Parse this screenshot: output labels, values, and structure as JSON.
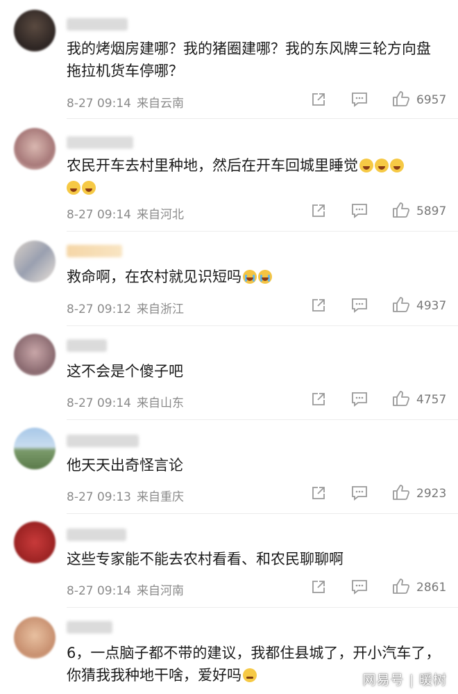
{
  "comments": [
    {
      "text": "我的烤烟房建哪？我的猪圈建哪？我的东风牌三轮方向盘拖拉机货车停哪？",
      "time": "8-27 09:14",
      "location": "来自云南",
      "likes": "6957",
      "emojis": []
    },
    {
      "text": "农民开车去村里种地，然后在开车回城里睡觉",
      "time": "8-27 09:14",
      "location": "来自河北",
      "likes": "5897",
      "emojis": [
        "laugh-cry-emoji",
        "laugh-cry-emoji",
        "laugh-cry-emoji",
        "laugh-cry-emoji",
        "laugh-cry-emoji"
      ]
    },
    {
      "text": "救命啊，在农村就见识短吗",
      "time": "8-27 09:12",
      "location": "来自浙江",
      "likes": "4937",
      "emojis": [
        "crying-emoji",
        "crying-emoji"
      ]
    },
    {
      "text": "这不会是个傻子吧",
      "time": "8-27 09:14",
      "location": "来自山东",
      "likes": "4757",
      "emojis": []
    },
    {
      "text": "他天天出奇怪言论",
      "time": "8-27 09:13",
      "location": "来自重庆",
      "likes": "2923",
      "emojis": []
    },
    {
      "text": "这些专家能不能去农村看看、和农民聊聊啊",
      "time": "8-27 09:14",
      "location": "来自河南",
      "likes": "2861",
      "emojis": []
    },
    {
      "text": "6，一点脑子都不带的建议，我都住县城了，开小汽车了，你猜我我种地干啥，爱好吗",
      "time": "",
      "location": "",
      "likes": "",
      "emojis": [
        "tired-emoji"
      ]
    }
  ],
  "watermark": "网易号 | 暖树"
}
